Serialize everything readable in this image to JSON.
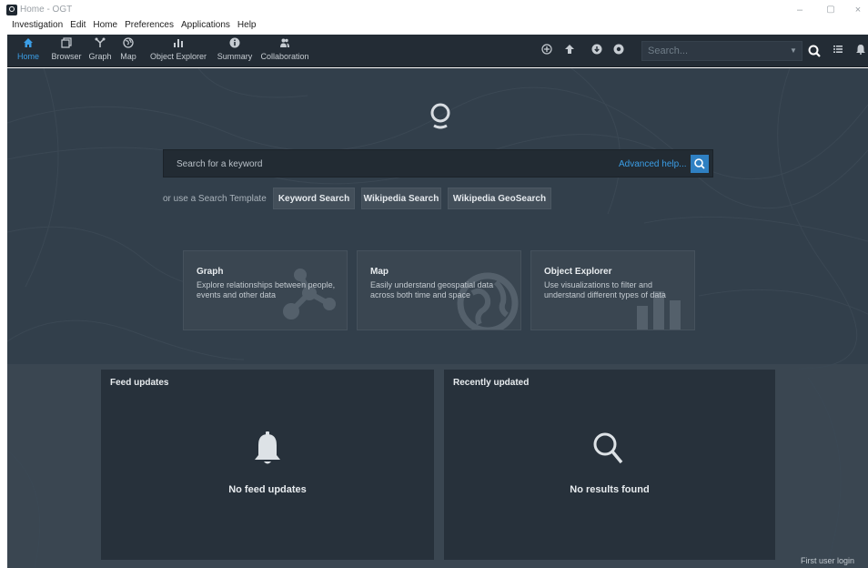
{
  "window": {
    "title": "Home - OGT",
    "controls": {
      "minimize": "–",
      "maximize": "▢",
      "close": "×"
    }
  },
  "menu": {
    "items": [
      "Investigation",
      "Edit",
      "Home",
      "Preferences",
      "Applications",
      "Help"
    ]
  },
  "nav": {
    "items": [
      {
        "label": "Home",
        "icon": "home-icon",
        "active": true
      },
      {
        "label": "Browser",
        "icon": "browser-icon",
        "active": false
      },
      {
        "label": "Graph",
        "icon": "graph-icon",
        "active": false
      },
      {
        "label": "Map",
        "icon": "map-globe-icon",
        "active": false
      },
      {
        "label": "Object Explorer",
        "icon": "bar-chart-icon",
        "active": false
      },
      {
        "label": "Summary",
        "icon": "info-icon",
        "active": false
      },
      {
        "label": "Collaboration",
        "icon": "people-icon",
        "active": false
      }
    ]
  },
  "toolbar": {
    "search_placeholder": "Search...",
    "accent": "#3b9ee6"
  },
  "home": {
    "keyword_placeholder": "Search for a keyword",
    "advanced_help": "Advanced help...",
    "template_label": "or use a Search Template",
    "templates": [
      "Keyword Search",
      "Wikipedia Search",
      "Wikipedia GeoSearch"
    ],
    "cards": [
      {
        "title": "Graph",
        "desc": "Explore relationships between people, events and other data"
      },
      {
        "title": "Map",
        "desc": "Easily understand geospatial data across both time and space"
      },
      {
        "title": "Object Explorer",
        "desc": "Use visualizations to filter and understand different types of data"
      }
    ],
    "feed": {
      "title": "Feed updates",
      "empty": "No feed updates"
    },
    "recent": {
      "title": "Recently updated",
      "empty": "No results found"
    },
    "first_login": "First user login"
  },
  "colors": {
    "toolbar_bg": "#232c35",
    "main_bg": "#323f4b",
    "panel_bg": "#27313b",
    "button_blue": "#2f80c2"
  }
}
